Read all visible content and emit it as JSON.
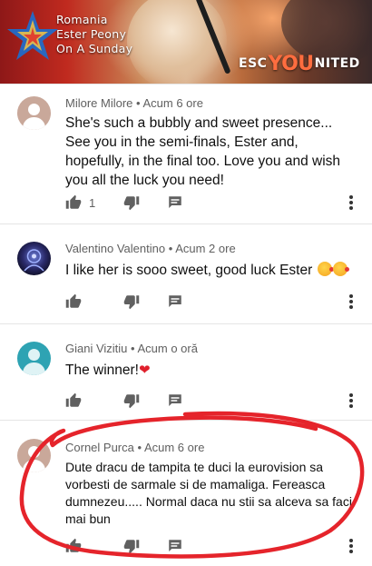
{
  "video": {
    "caption_lines": [
      "Romania",
      "Ester Peony",
      "On A Sunday"
    ],
    "brand": {
      "part1": "ESC",
      "part2": "YOU",
      "part3": "NITED"
    }
  },
  "comments": [
    {
      "author": "Milore Milore",
      "time": "Acum 6 ore",
      "text": "She's such a bubbly and sweet presence... See you in the semi-finals, Ester and, hopefully, in the final too. Love you and wish you all the luck you need!",
      "likes": "1"
    },
    {
      "author": "Valentino Valentino",
      "time": "Acum 2 ore",
      "text": "I like her is sooo sweet, good luck Ester ",
      "likes": ""
    },
    {
      "author": "Giani Vizitiu",
      "time": "Acum o oră",
      "text": "The winner!",
      "likes": ""
    },
    {
      "author": "Cornel Purca",
      "time": "Acum 6 ore",
      "text": "Dute dracu de tampita te duci la eurovision sa vorbesti de sarmale si de mamaliga. Fereasca dumnezeu..... Normal daca nu stii sa alceva sa faci mai bun",
      "likes": ""
    }
  ],
  "separator": "•",
  "colors": {
    "annotation": "#e5242b",
    "accent_orange": "#ff6d3f",
    "meta_text": "#606060"
  },
  "icons": [
    "thumbs-up-icon",
    "thumbs-down-icon",
    "reply-icon",
    "more-vert-icon"
  ]
}
